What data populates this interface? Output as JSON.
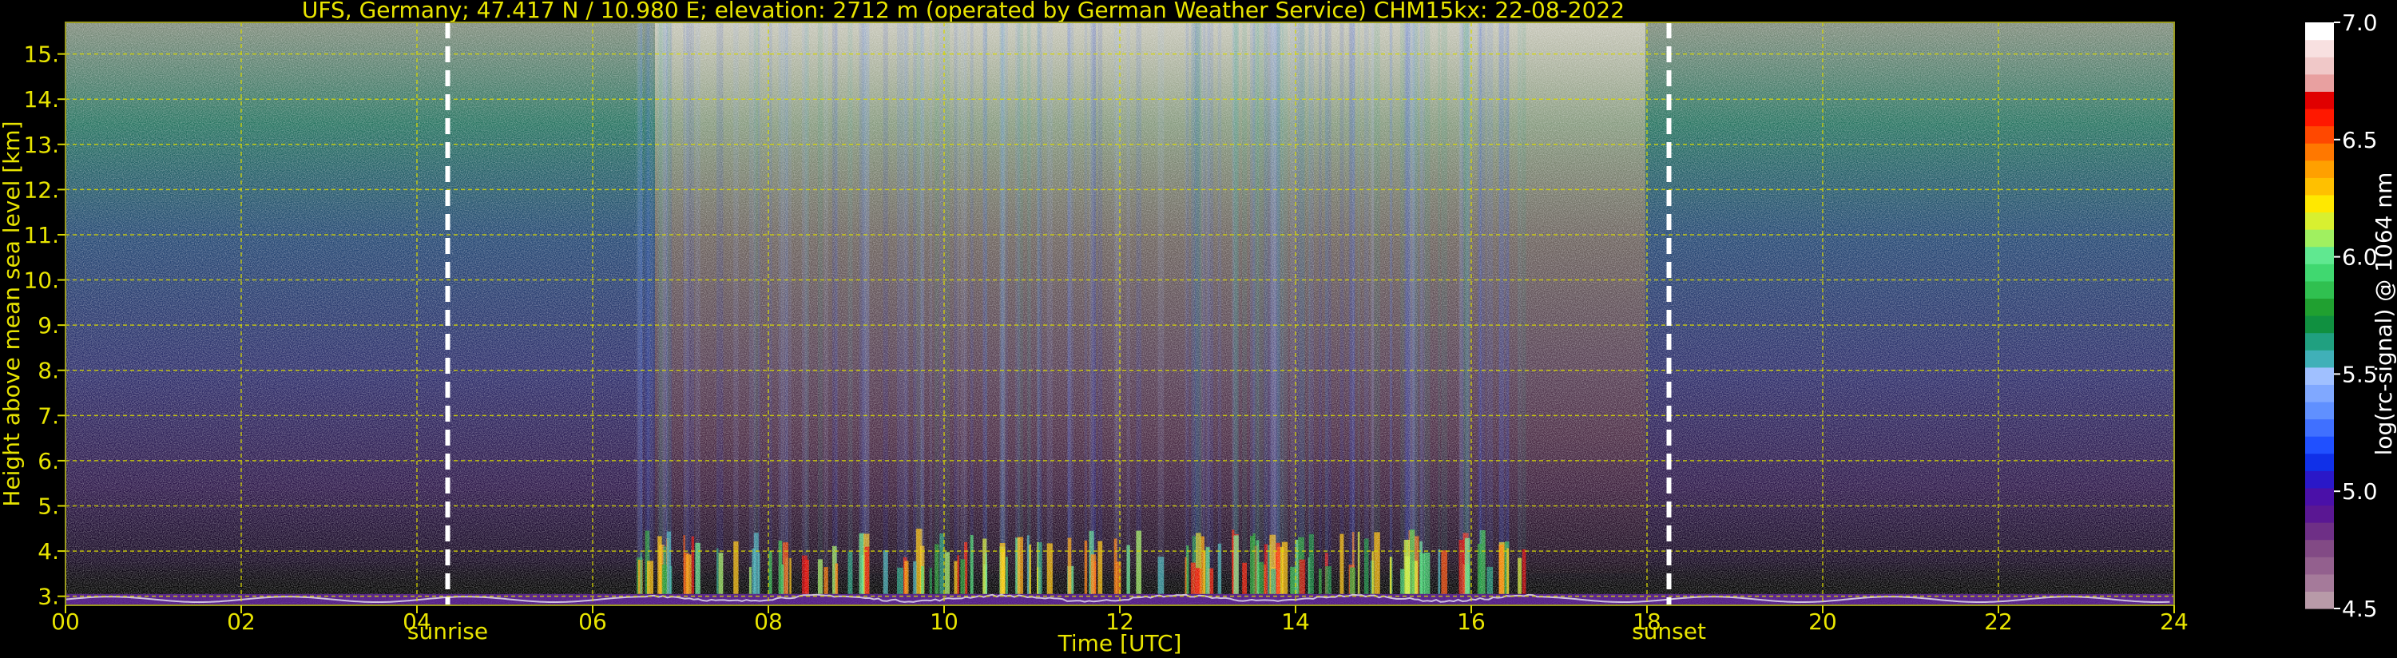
{
  "chart_data": {
    "type": "heatmap",
    "title": "UFS, Germany; 47.417 N / 10.980 E; elevation: 2712 m  (operated by German Weather Service)    CHM15kx: 22-08-2022",
    "xlabel": "Time [UTC]",
    "ylabel": "Height above mean sea level [km]",
    "xlim": [
      0,
      24
    ],
    "ylim": [
      2.8,
      15.7
    ],
    "x_ticks": [
      0,
      2,
      4,
      6,
      8,
      10,
      12,
      14,
      16,
      18,
      20,
      22,
      24
    ],
    "x_tick_labels": [
      "00",
      "02",
      "04",
      "06",
      "08",
      "10",
      "12",
      "14",
      "16",
      "18",
      "20",
      "22",
      "24"
    ],
    "y_ticks": [
      3,
      4,
      5,
      6,
      7,
      8,
      9,
      10,
      11,
      12,
      13,
      14,
      15
    ],
    "y_tick_labels": [
      "3.",
      "4.",
      "5.",
      "6.",
      "7.",
      "8.",
      "9.",
      "10.",
      "11.",
      "12.",
      "13.",
      "14.",
      "15."
    ],
    "grid": true,
    "markers": [
      {
        "label": "sunrise",
        "x": 4.35
      },
      {
        "label": "sunset",
        "x": 18.25
      }
    ],
    "colorbar": {
      "label": "log(rc-signal) @ 1064 nm",
      "range": [
        4.5,
        7.0
      ],
      "tick_labels": [
        "4.5",
        "5.0",
        "5.5",
        "6.0",
        "6.5",
        "7.0"
      ],
      "ticks": [
        4.5,
        5.0,
        5.5,
        6.0,
        6.5,
        7.0
      ],
      "colors": [
        "#b89aa8",
        "#a57a9a",
        "#93608e",
        "#824a85",
        "#6e2f86",
        "#5a1793",
        "#4a10a8",
        "#2a18c8",
        "#1030e8",
        "#2050ff",
        "#4070ff",
        "#6090ff",
        "#80a8ff",
        "#a0c0ff",
        "#40b0b8",
        "#20a080",
        "#109040",
        "#20a030",
        "#30c050",
        "#40d870",
        "#60e890",
        "#a0f060",
        "#d8f030",
        "#ffe800",
        "#ffc000",
        "#ffa000",
        "#ff7800",
        "#ff4800",
        "#ff1800",
        "#e00000",
        "#e8a0a0",
        "#f0c8c8",
        "#f8e0e0",
        "#ffffff"
      ]
    }
  }
}
